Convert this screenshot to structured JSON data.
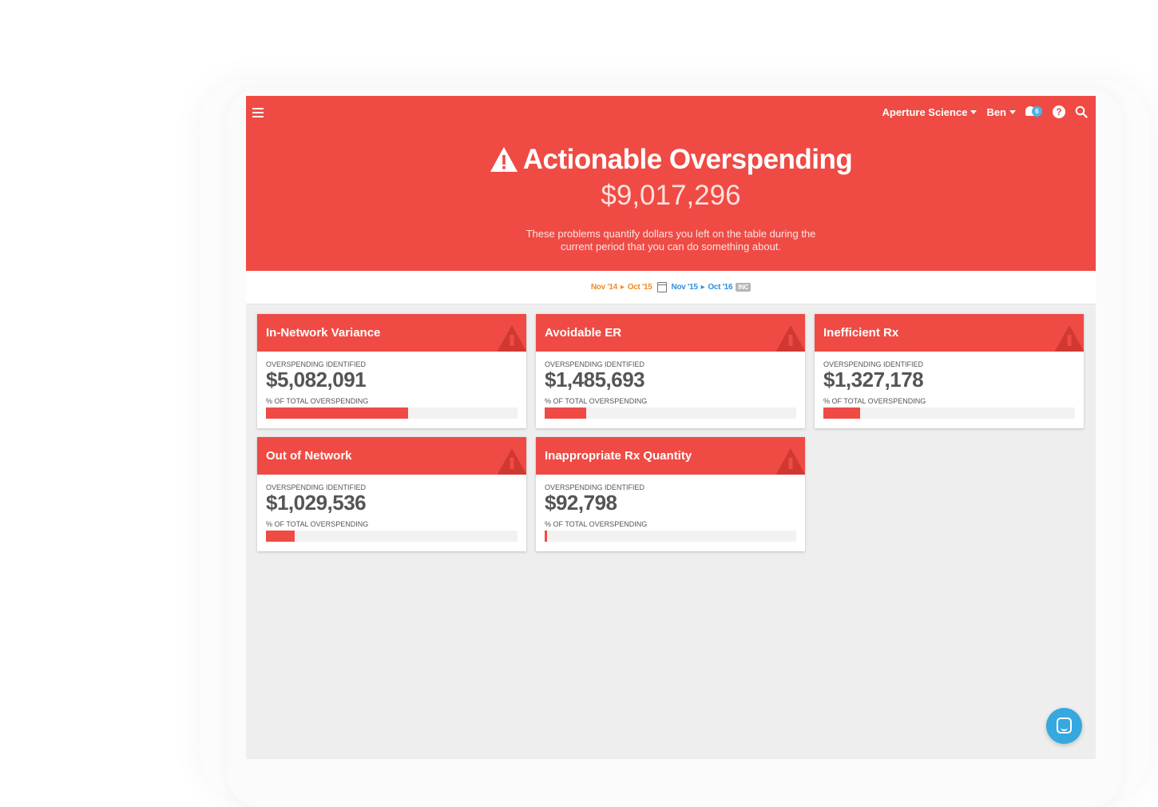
{
  "colors": {
    "accent": "#ef4b44",
    "date_prev": "#f08a24",
    "date_current": "#2e8fe0",
    "chat": "#35a8e0"
  },
  "topbar": {
    "org": "Aperture Science",
    "user": "Ben",
    "notification_count": "6",
    "help_glyph": "?"
  },
  "hero": {
    "title": "Actionable Overspending",
    "amount": "$9,017,296",
    "description": "These problems quantify dollars you left on the table during the current period that you can do something about."
  },
  "date_range": {
    "prev_start": "Nov '14",
    "prev_end": "Oct '15",
    "cur_start": "Nov '15",
    "cur_end": "Oct '16",
    "badge": "INC"
  },
  "card_labels": {
    "identified": "OVERSPENDING IDENTIFIED",
    "percent": "% OF TOTAL OVERSPENDING"
  },
  "cards": [
    {
      "title": "In-Network Variance",
      "amount": "$5,082,091",
      "percent_of_total": 56.4
    },
    {
      "title": "Avoidable ER",
      "amount": "$1,485,693",
      "percent_of_total": 16.5
    },
    {
      "title": "Inefficient Rx",
      "amount": "$1,327,178",
      "percent_of_total": 14.7
    },
    {
      "title": "Out of Network",
      "amount": "$1,029,536",
      "percent_of_total": 11.4
    },
    {
      "title": "Inappropriate Rx Quantity",
      "amount": "$92,798",
      "percent_of_total": 1.0
    }
  ],
  "icons": [
    "menu-icon",
    "caret-down-icon",
    "notification-icon",
    "help-icon",
    "search-icon",
    "warning-icon",
    "calendar-icon",
    "chat-icon"
  ]
}
